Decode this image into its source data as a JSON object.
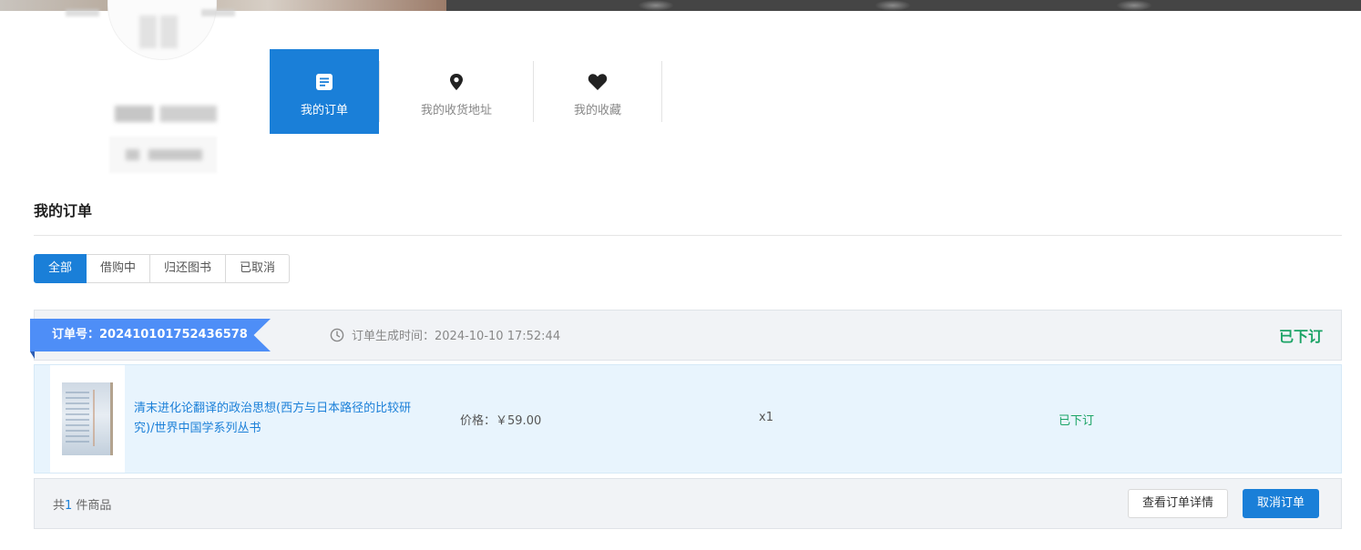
{
  "tabs": [
    {
      "label": "我的订单",
      "icon": "order-list-icon",
      "active": true
    },
    {
      "label": "我的收货地址",
      "icon": "map-pin-icon",
      "active": false
    },
    {
      "label": "我的收藏",
      "icon": "heart-icon",
      "active": false
    }
  ],
  "section": {
    "title": "我的订单"
  },
  "filters": [
    "全部",
    "借购中",
    "归还图书",
    "已取消"
  ],
  "order": {
    "number_label": "订单号：",
    "number": "202410101752436578",
    "time_label": "订单生成时间：",
    "time": "2024-10-10 17:52:44",
    "status": "已下订",
    "item": {
      "title": "清末进化论翻译的政治思想(西方与日本路径的比较研究)/世界中国学系列丛书",
      "price_label": "价格：",
      "price": "￥59.00",
      "qty": "x1",
      "status": "已下订"
    },
    "count_prefix": "共",
    "count": "1",
    "count_suffix": " 件商品",
    "detail_button": "查看订单详情",
    "cancel_button": "取消订单"
  },
  "colors": {
    "primary": "#1a7fd8",
    "success": "#1aa365",
    "ribbon": "#4e8ef7"
  }
}
